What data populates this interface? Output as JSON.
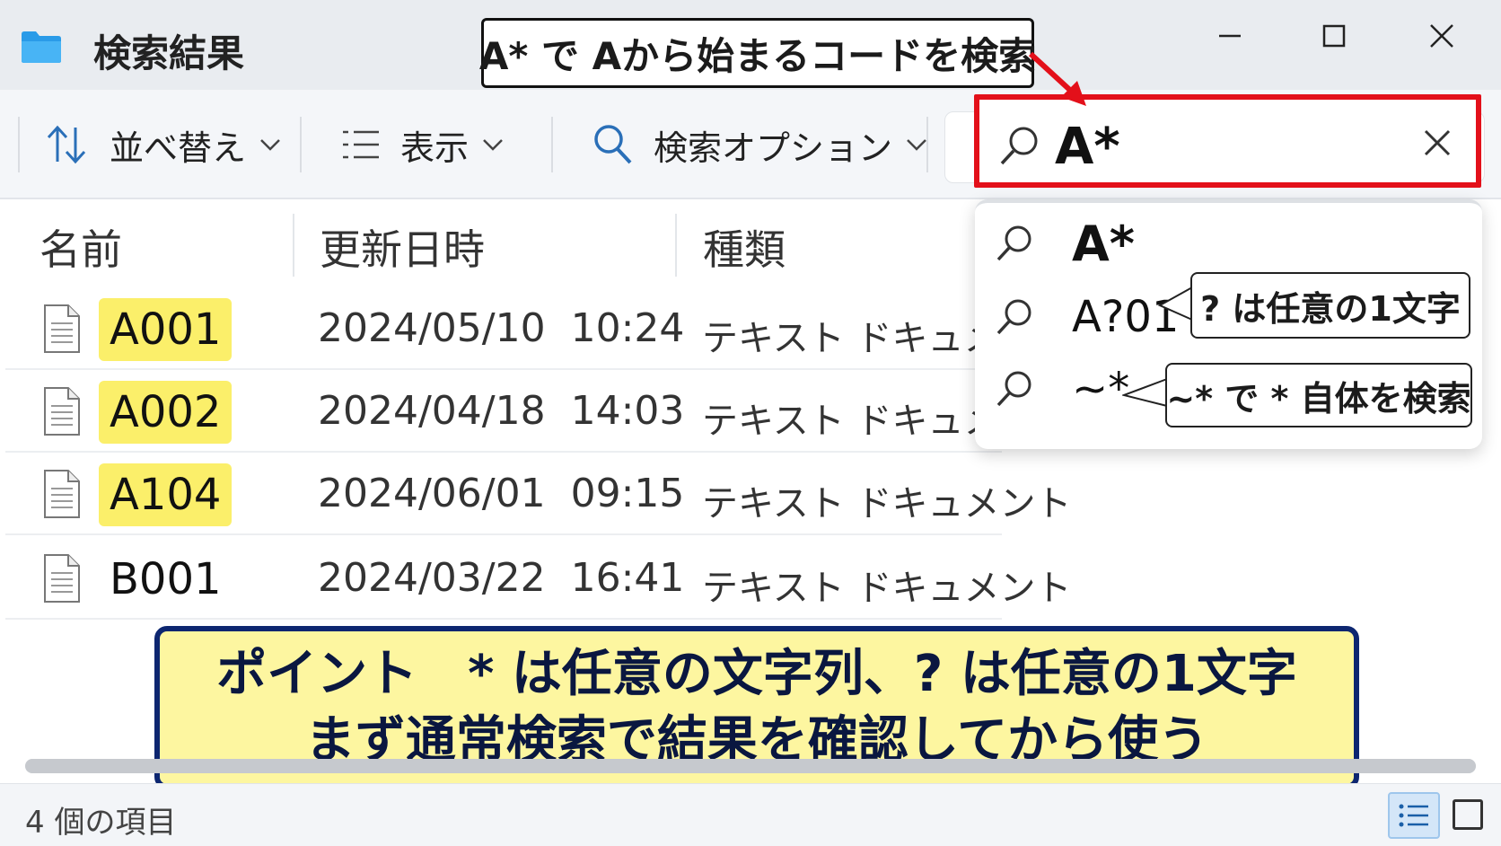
{
  "window": {
    "title": "検索結果",
    "annotation": "A* で Aから始まるコードを検索"
  },
  "toolbar": {
    "sort_label": "並べ替え",
    "view_label": "表示",
    "search_options_label": "検索オプション"
  },
  "search": {
    "value": "A*",
    "suggestions": [
      {
        "text": "A*"
      },
      {
        "text": "A?01",
        "callout": "? は任意の1文字"
      },
      {
        "text": "~*",
        "callout": "~* で * 自体を検索"
      }
    ]
  },
  "columns": [
    "名前",
    "更新日時",
    "種類"
  ],
  "files": [
    {
      "name": "A001",
      "modified": "2024/05/10  10:24",
      "type": "テキスト ドキュメント",
      "highlighted": true
    },
    {
      "name": "A002",
      "modified": "2024/04/18  14:03",
      "type": "テキスト ドキュメント",
      "highlighted": true
    },
    {
      "name": "A104",
      "modified": "2024/06/01  09:15",
      "type": "テキスト ドキュメント",
      "highlighted": true
    },
    {
      "name": "B001",
      "modified": "2024/03/22  16:41",
      "type": "テキスト ドキュメント",
      "highlighted": false
    }
  ],
  "point": {
    "line1": "ポイント　* は任意の文字列、? は任意の1文字",
    "line2": "まず通常検索で結果を確認してから使う"
  },
  "status": {
    "item_count": "4 個の項目"
  },
  "colors": {
    "highlight": "#fbef6a",
    "search_border": "#e3101a",
    "point_border": "#0d2670",
    "point_bg": "#fdf6a0"
  },
  "icons": [
    "folder-icon",
    "minimize-icon",
    "maximize-icon",
    "close-icon",
    "sort-icon",
    "view-icon",
    "search-icon",
    "clear-icon",
    "file-icon",
    "details-view-icon",
    "tiles-view-icon"
  ]
}
